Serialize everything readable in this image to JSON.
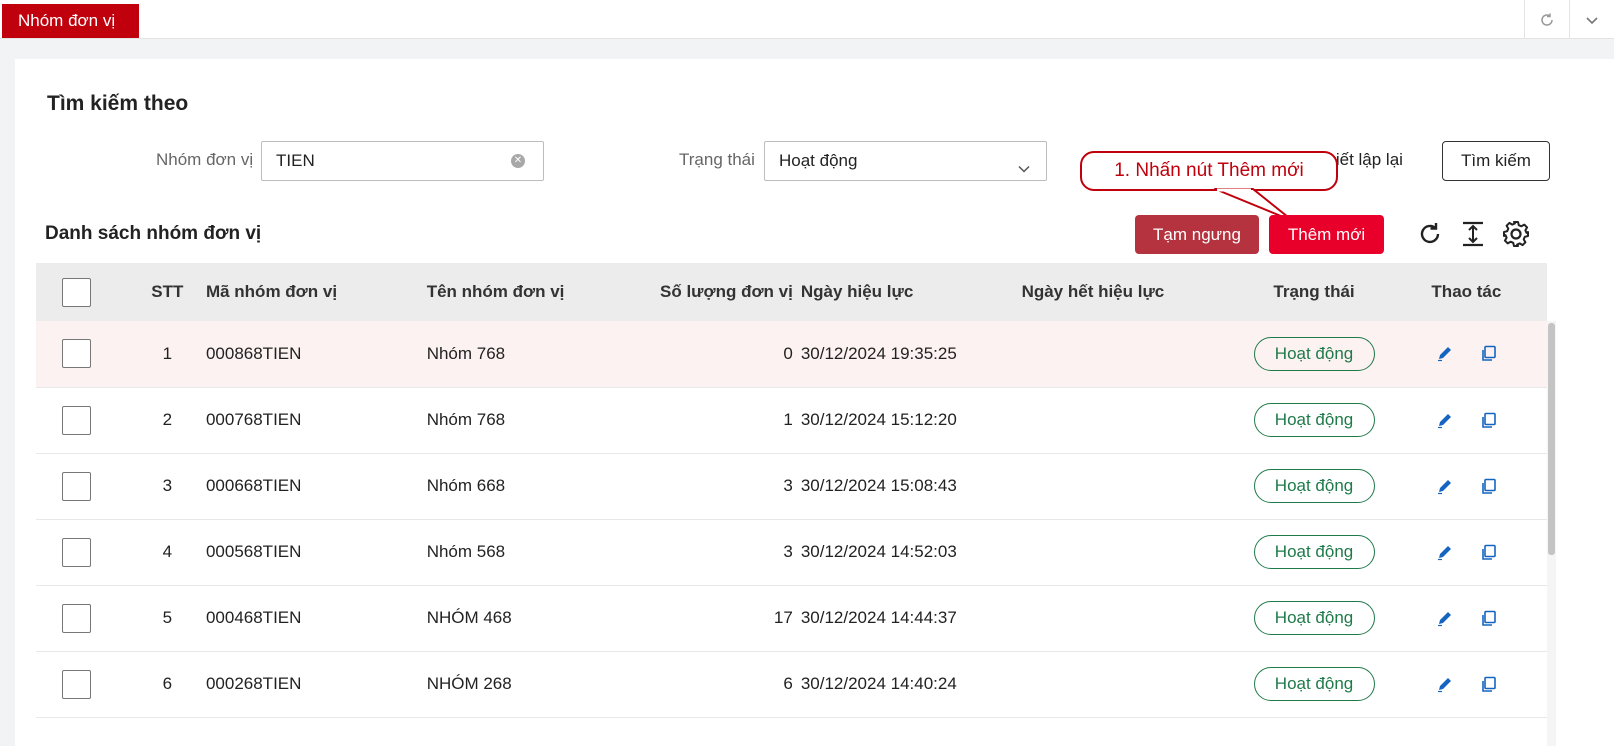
{
  "topbar": {
    "active_tab": "Nhóm đơn vị",
    "icons": [
      "refresh-icon",
      "chevron-down-icon"
    ]
  },
  "search": {
    "title": "Tìm kiếm theo",
    "group_label": "Nhóm đơn vị",
    "group_value": "TIEN",
    "status_label": "Trạng thái",
    "status_value": "Hoạt động",
    "reset_label": "Thiết lập lại",
    "search_label": "Tìm kiếm"
  },
  "callout": {
    "text": "1. Nhấn nút Thêm mới"
  },
  "list": {
    "title": "Danh sách nhóm đơn vị",
    "suspend_label": "Tạm ngưng",
    "add_label": "Thêm mới"
  },
  "colors": {
    "brand_red": "#c0000c",
    "suspend": "#b5323f",
    "add": "#e8002a",
    "status_green": "#1f7a4a"
  },
  "table": {
    "headers": [
      "STT",
      "Mã nhóm đơn vị",
      "Tên nhóm đơn vị",
      "Số lượng đơn vị",
      "Ngày hiệu lực",
      "Ngày hết hiệu lực",
      "Trạng thái",
      "Thao tác"
    ],
    "rows": [
      {
        "stt": "1",
        "code": "000868TIEN",
        "name": "Nhóm 768",
        "qty": "0",
        "effective": "30/12/2024 19:35:25",
        "expiry": "",
        "status": "Hoạt động"
      },
      {
        "stt": "2",
        "code": "000768TIEN",
        "name": "Nhóm 768",
        "qty": "1",
        "effective": "30/12/2024 15:12:20",
        "expiry": "",
        "status": "Hoạt động"
      },
      {
        "stt": "3",
        "code": "000668TIEN",
        "name": "Nhóm 668",
        "qty": "3",
        "effective": "30/12/2024 15:08:43",
        "expiry": "",
        "status": "Hoạt động"
      },
      {
        "stt": "4",
        "code": "000568TIEN",
        "name": "Nhóm 568",
        "qty": "3",
        "effective": "30/12/2024 14:52:03",
        "expiry": "",
        "status": "Hoạt động"
      },
      {
        "stt": "5",
        "code": "000468TIEN",
        "name": "NHÓM 468",
        "qty": "17",
        "effective": "30/12/2024 14:44:37",
        "expiry": "",
        "status": "Hoạt động"
      },
      {
        "stt": "6",
        "code": "000268TIEN",
        "name": "NHÓM 268",
        "qty": "6",
        "effective": "30/12/2024 14:40:24",
        "expiry": "",
        "status": "Hoạt động"
      }
    ]
  }
}
